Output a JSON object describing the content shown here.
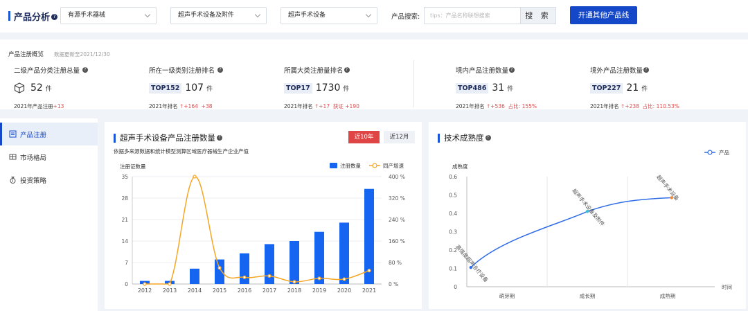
{
  "header": {
    "title": "产品分析",
    "help": "?",
    "selects": [
      "有源手术器械",
      "超声手术设备及附件",
      "超声手术设备"
    ],
    "search_label": "产品搜索:",
    "search_placeholder": "tips：产品名称联想搜索",
    "search_button": "搜 索",
    "open_button": "开通其他产品线"
  },
  "overview": {
    "heading": "产品注册概览",
    "update_note": "数据更新至2021/12/30",
    "help": "?",
    "stats": [
      {
        "label": "二级产品分类注册总量",
        "rank": "",
        "value": "52",
        "unit": "件",
        "foot_prefix": "2021年产品注册",
        "foot_a": "+13",
        "foot_b": ""
      },
      {
        "label": "所在一级类别注册排名",
        "rank": "TOP152",
        "value": "107",
        "unit": "件",
        "foot_prefix": "2021年排名",
        "foot_a": "↑+164",
        "foot_b": "+38"
      },
      {
        "label": "所属大类注册量排名",
        "rank": "TOP17",
        "value": "1730",
        "unit": "件",
        "foot_prefix": "2021年排名",
        "foot_a": "↑+17",
        "foot_b": "获证 +190"
      },
      {
        "label": "境内产品注册数量",
        "rank": "TOP486",
        "value": "31",
        "unit": "件",
        "foot_prefix": "2021年排名",
        "foot_a": "↑+536",
        "foot_b": "占比: 155%"
      },
      {
        "label": "境外产品注册数量",
        "rank": "TOP227",
        "value": "21",
        "unit": "件",
        "foot_prefix": "2021年排名",
        "foot_a": "↑+238",
        "foot_b": "占比: 110.53%"
      }
    ]
  },
  "sidebar": {
    "items": [
      {
        "label": "产品注册",
        "icon": "register-icon"
      },
      {
        "label": "市场格局",
        "icon": "market-icon"
      },
      {
        "label": "投资策略",
        "icon": "money-bag-icon"
      }
    ]
  },
  "left_panel": {
    "title": "超声手术设备产品注册数量",
    "help": "?",
    "toggle_on": "近10年",
    "toggle_off": "近12月",
    "note": "依据多来源数据和统计模型测算区域医疗器械生产企业产值"
  },
  "right_panel": {
    "title": "技术成熟度",
    "help": "?"
  },
  "chart_data": [
    {
      "type": "bar",
      "ylabel": "注册证数量",
      "categories": [
        "2012",
        "2013",
        "2014",
        "2015",
        "2016",
        "2017",
        "2018",
        "2019",
        "2020",
        "2021"
      ],
      "series": [
        {
          "name": "注册数量",
          "type": "bar",
          "values": [
            1,
            1,
            5,
            8,
            10,
            13,
            14,
            17,
            20,
            31
          ],
          "color": "#1565f0"
        },
        {
          "name": "同产增速",
          "type": "line",
          "axis": "right",
          "values": [
            0,
            0,
            400,
            60,
            25,
            30,
            8,
            21,
            18,
            50
          ],
          "color": "#f5a623"
        }
      ],
      "ylim": [
        0,
        35
      ],
      "yticks": [
        "0",
        "7",
        "14",
        "21",
        "28",
        "35"
      ],
      "y2lim": [
        0,
        400
      ],
      "y2ticks": [
        "0 %",
        "80 %",
        "160 %",
        "240 %",
        "320 %",
        "400 %"
      ],
      "legend": "top-right",
      "grid": true
    },
    {
      "type": "line",
      "ylabel": "成熟度",
      "xlabel": "时间",
      "categories": [
        "萌芽期",
        "成长期",
        "成熟期"
      ],
      "ylim": [
        0,
        0.6
      ],
      "yticks": [
        "0",
        "0.1",
        "0.2",
        "0.3",
        "0.4",
        "0.5",
        "0.6"
      ],
      "series": [
        {
          "name": "产品",
          "color": "#2f6de6"
        }
      ],
      "points": [
        {
          "label": "高强度超声治疗设备",
          "x": 0.05,
          "y": 0.105,
          "color": "#2f6de6"
        },
        {
          "label": "超声手术设备及附件",
          "x": 1.5,
          "y": 0.41,
          "color": "#35c1d6"
        },
        {
          "label": "超声手术设备",
          "x": 2.55,
          "y": 0.485,
          "color": "#f08a3c"
        }
      ],
      "legend": "top-right"
    }
  ]
}
